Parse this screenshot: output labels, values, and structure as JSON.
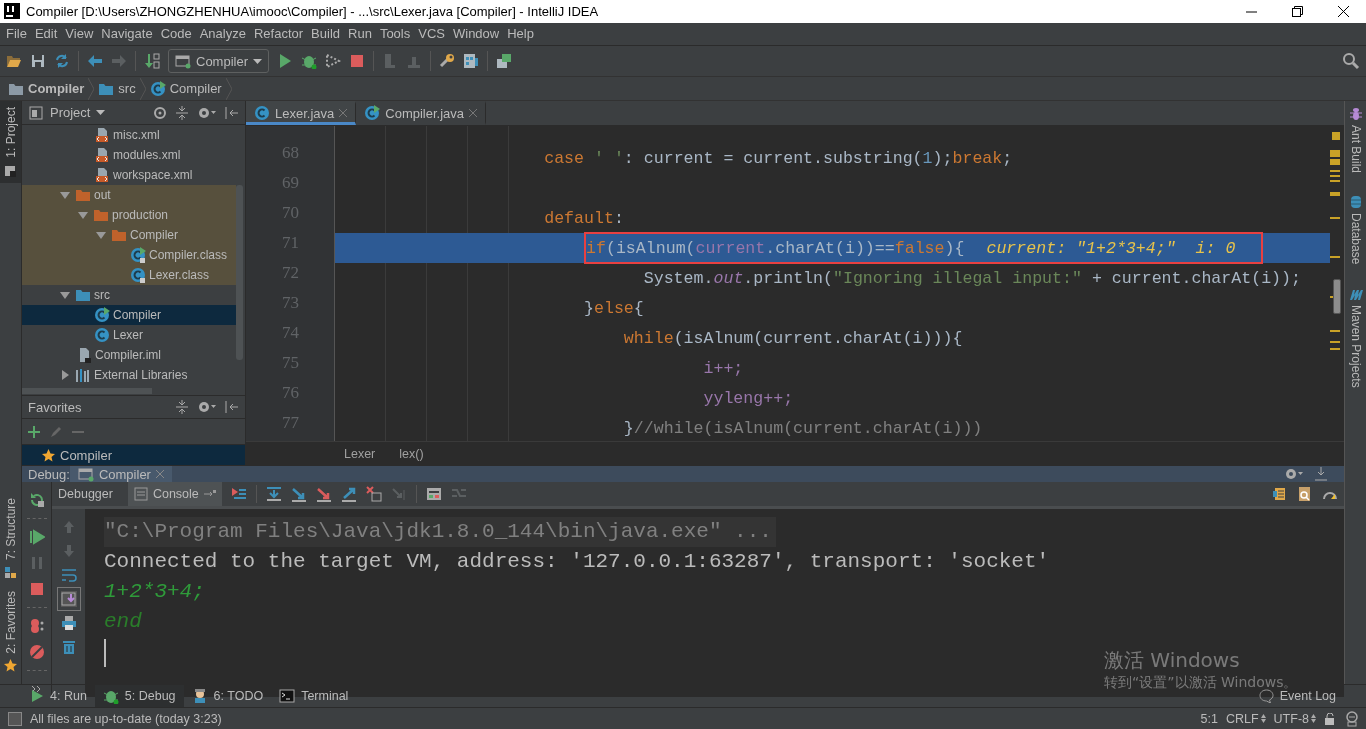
{
  "window": {
    "title": "Compiler [D:\\Users\\ZHONGZHENHUA\\imooc\\Compiler] - ...\\src\\Lexer.java [Compiler] - IntelliJ IDEA"
  },
  "menu": [
    "File",
    "Edit",
    "View",
    "Navigate",
    "Code",
    "Analyze",
    "Refactor",
    "Build",
    "Run",
    "Tools",
    "VCS",
    "Window",
    "Help"
  ],
  "toolbar": {
    "run_configuration": "Compiler"
  },
  "breadcrumbs": [
    {
      "label": "Compiler",
      "kind": "project"
    },
    {
      "label": "src",
      "kind": "folder"
    },
    {
      "label": "Compiler",
      "kind": "run-class"
    }
  ],
  "left_tool_tabs": [
    {
      "label": "1: Project",
      "kind": "project",
      "selected": true
    },
    {
      "label": "7: Structure",
      "kind": "structure",
      "selected": false
    },
    {
      "label": "2: Favorites",
      "kind": "favorites",
      "selected": false
    }
  ],
  "right_tool_tabs": [
    {
      "label": "Ant Build",
      "kind": "ant"
    },
    {
      "label": "Database",
      "kind": "database"
    },
    {
      "label": "Maven Projects",
      "kind": "maven"
    }
  ],
  "project_panel": {
    "title": "Project",
    "tree": [
      {
        "children": [
          {
            "label": "misc.xml",
            "kind": "xml",
            "selected": false,
            "excluded": false
          },
          {
            "label": "modules.xml",
            "kind": "xml",
            "selected": false,
            "excluded": false
          },
          {
            "label": "workspace.xml",
            "kind": "xml",
            "selected": false,
            "excluded": false
          }
        ]
      },
      {
        "label": "out",
        "kind": "excluded-folder",
        "selected": false,
        "excluded": true,
        "expanded": true,
        "children": [
          {
            "label": "production",
            "kind": "excluded-folder",
            "selected": false,
            "excluded": true,
            "expanded": true,
            "children": [
              {
                "label": "Compiler",
                "kind": "excluded-folder",
                "selected": false,
                "excluded": true,
                "expanded": true,
                "children": [
                  {
                    "label": "Compiler.class",
                    "kind": "run-class-file",
                    "selected": false,
                    "excluded": true
                  },
                  {
                    "label": "Lexer.class",
                    "kind": "class-file",
                    "selected": false,
                    "excluded": true
                  }
                ]
              }
            ]
          }
        ]
      },
      {
        "label": "src",
        "kind": "source-folder",
        "selected": false,
        "excluded": false,
        "expanded": true,
        "children": [
          {
            "label": "Compiler",
            "kind": "run-class",
            "selected": true,
            "excluded": false
          },
          {
            "label": "Lexer",
            "kind": "class",
            "selected": false,
            "excluded": false
          }
        ]
      },
      {
        "label": "Compiler.iml",
        "kind": "module-file",
        "selected": false,
        "excluded": false
      },
      {
        "label": "External Libraries",
        "kind": "libraries",
        "selected": false,
        "excluded": false,
        "expanded": false
      }
    ]
  },
  "favorites_panel": {
    "title": "Favorites",
    "items": [
      {
        "label": "Compiler",
        "selected": true
      }
    ]
  },
  "editor": {
    "tabs": [
      {
        "label": "Lexer.java",
        "kind": "class",
        "selected": true
      },
      {
        "label": "Compiler.java",
        "kind": "run-class",
        "selected": false
      }
    ],
    "lines": [
      {
        "number": "68",
        "current": false,
        "annotated": false,
        "tokens": [
          {
            "text": "                    case ",
            "kind": "keyword"
          },
          {
            "text": "' '",
            "kind": "string"
          },
          {
            "text": ": current = current.substring(",
            "kind": "plain"
          },
          {
            "text": "1",
            "kind": "number"
          },
          {
            "text": ");",
            "kind": "plain"
          },
          {
            "text": "break",
            "kind": "keyword"
          },
          {
            "text": ";",
            "kind": "plain"
          }
        ]
      },
      {
        "number": "69",
        "current": false,
        "annotated": false
      },
      {
        "number": "70",
        "current": false,
        "annotated": false,
        "tokens": [
          {
            "text": "                    default",
            "kind": "keyword"
          },
          {
            "text": ":",
            "kind": "plain"
          }
        ]
      },
      {
        "number": "71",
        "current": true,
        "annotated": true,
        "tokens": [
          {
            "text": "                        if",
            "kind": "keyword"
          },
          {
            "text": "(isAlnum(",
            "kind": "plain"
          },
          {
            "text": "current",
            "kind": "field"
          },
          {
            "text": ".charAt(i))==",
            "kind": "plain"
          },
          {
            "text": "false",
            "kind": "keyword"
          },
          {
            "text": "){",
            "kind": "plain"
          }
        ],
        "inline_values": "current: \"1+2*3+4;\"  i: 0"
      },
      {
        "number": "72",
        "current": false,
        "annotated": false,
        "tokens": [
          {
            "text": "                              System.",
            "kind": "plain"
          },
          {
            "text": "out",
            "kind": "static"
          },
          {
            "text": ".println(",
            "kind": "plain"
          },
          {
            "text": "\"Ignoring illegal input:\"",
            "kind": "string"
          },
          {
            "text": " + current.charAt(i));",
            "kind": "plain"
          }
        ]
      },
      {
        "number": "73",
        "current": false,
        "annotated": false,
        "tokens": [
          {
            "text": "                        }",
            "kind": "plain"
          },
          {
            "text": "else",
            "kind": "keyword"
          },
          {
            "text": "{",
            "kind": "plain"
          }
        ]
      },
      {
        "number": "74",
        "current": false,
        "annotated": false,
        "tokens": [
          {
            "text": "                            while",
            "kind": "keyword"
          },
          {
            "text": "(isAlnum(current.charAt(i))){",
            "kind": "plain"
          }
        ]
      },
      {
        "number": "75",
        "current": false,
        "annotated": false,
        "tokens": [
          {
            "text": "                                    i++;",
            "kind": "field"
          }
        ]
      },
      {
        "number": "76",
        "current": false,
        "annotated": false,
        "tokens": [
          {
            "text": "                                    yyleng++;",
            "kind": "field"
          }
        ]
      },
      {
        "number": "77",
        "current": false,
        "annotated": false,
        "tokens": [
          {
            "text": "                            }",
            "kind": "plain"
          },
          {
            "text": "//while(isAlnum(current.charAt(i)))",
            "kind": "comment"
          }
        ]
      }
    ],
    "breadcrumbs": [
      "Lexer",
      "lex()"
    ]
  },
  "debug_panel": {
    "label": "Debug:",
    "sessions": [
      {
        "label": "Compiler",
        "selected": true
      }
    ],
    "views": [
      {
        "label": "Debugger",
        "selected": false
      },
      {
        "label": "Console",
        "selected": true
      }
    ],
    "console": [
      {
        "text": "\"C:\\Program Files\\Java\\jdk1.8.0_144\\bin\\java.exe\" ...",
        "kind": "command"
      },
      {
        "text": "Connected to the target VM, address: '127.0.0.1:63287', transport: 'socket'",
        "kind": "system"
      },
      {
        "text": "1+2*3+4;",
        "kind": "input"
      },
      {
        "text": "end",
        "kind": "output"
      }
    ]
  },
  "bottom_tool_tabs": [
    {
      "label": "4: Run",
      "kind": "run",
      "selected": false
    },
    {
      "label": "5: Debug",
      "kind": "debug",
      "selected": true
    },
    {
      "label": "6: TODO",
      "kind": "todo",
      "selected": false
    },
    {
      "label": "Terminal",
      "kind": "terminal",
      "selected": false
    }
  ],
  "event_log": "Event Log",
  "status_bar": {
    "message": "All files are up-to-date (today 3:23)",
    "position": "5:1",
    "line_separator": "CRLF",
    "encoding": "UTF-8"
  },
  "os_notice": {
    "title": "激活 Windows",
    "message": "转到“设置”以激活 Windows。"
  }
}
